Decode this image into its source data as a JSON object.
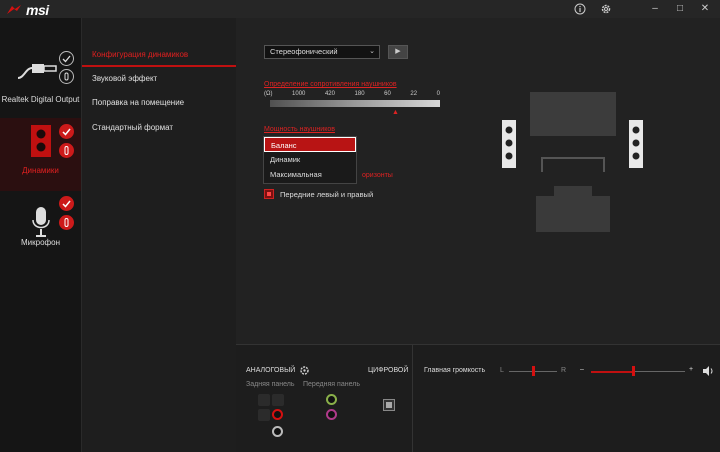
{
  "app": {
    "logo_text": "msi",
    "window_controls": [
      "info-icon",
      "gear-icon",
      "minimize-icon",
      "maximize-icon",
      "close-icon"
    ]
  },
  "devices": [
    {
      "label": "Realtek Digital Output",
      "icon": "digital-plug-icon",
      "active": false
    },
    {
      "label": "Динамики",
      "icon": "speaker-icon",
      "active": true
    },
    {
      "label": "Микрофон",
      "icon": "microphone-icon",
      "active": false
    }
  ],
  "menu": {
    "items": [
      {
        "label": "Конфигурация динамиков",
        "active": true
      },
      {
        "label": "Звуковой эффект",
        "active": false
      },
      {
        "label": "Поправка на помещение",
        "active": false
      },
      {
        "label": "Стандартный формат",
        "active": false
      }
    ]
  },
  "config": {
    "speaker_select": "Стереофонический",
    "headphone_impedance_label": "Определение сопротивления наушников",
    "impedance_scale": [
      "(Ω)",
      "1000",
      "420",
      "180",
      "60",
      "22",
      "0"
    ],
    "headphone_power_label": "Мощность наушников",
    "power_options": [
      "Баланс",
      "Динамик",
      "Максимальная"
    ],
    "selected_power": "Баланс",
    "fullrange_label": "оризонты",
    "front_lr_label": "Передние левый и правый"
  },
  "connectors": {
    "analog_label": "АНАЛОГОВЫЙ",
    "digital_label": "ЦИФРОВОЙ",
    "rear_panel_label": "Задняя панель",
    "front_panel_label": "Передняя панель"
  },
  "volume": {
    "label": "Главная громкость",
    "left_label": "L",
    "right_label": "R",
    "minus_label": "–",
    "plus_label": "+",
    "balance": 0.5,
    "level": 0.45
  },
  "colors": {
    "accent": "#d51010",
    "background": "#1a1a1a"
  }
}
